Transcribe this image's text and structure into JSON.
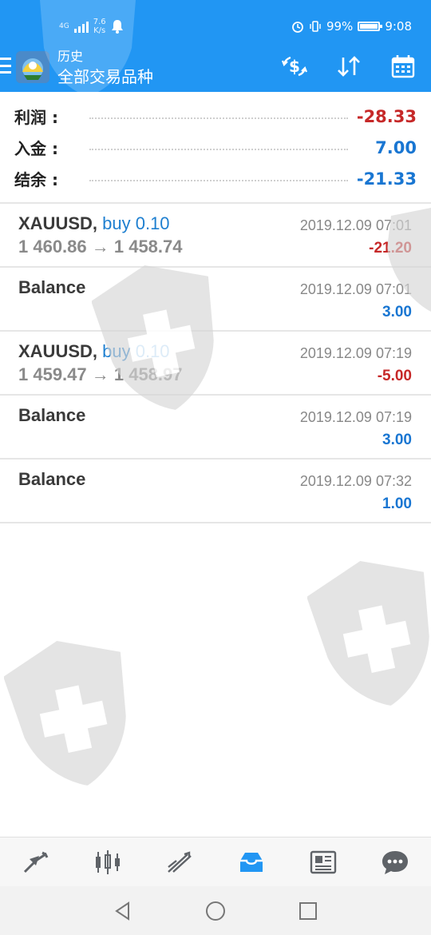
{
  "status_bar": {
    "network": "4G",
    "speed_value": "7.6",
    "speed_unit": "K/s",
    "battery": "99%",
    "time": "9:08"
  },
  "header": {
    "subtitle": "历史",
    "title": "全部交易品种",
    "icons": [
      "menu-icon",
      "currency-exchange-icon",
      "sort-icon",
      "calendar-icon"
    ]
  },
  "summary": {
    "profit_label": "利润 :",
    "profit_value": "-28.33",
    "deposit_label": "入金 :",
    "deposit_value": "7.00",
    "balance_label": "结余 :",
    "balance_value": "-21.33"
  },
  "history": [
    {
      "symbol": "XAUUSD,",
      "side": "buy 0.10",
      "prices": "1 460.86 → 1 458.74",
      "date": "2019.12.09 07:01",
      "amount": "-21.20"
    },
    {
      "symbol": "Balance",
      "side": "",
      "prices": "",
      "date": "2019.12.09 07:01",
      "amount": "3.00"
    },
    {
      "symbol": "XAUUSD,",
      "side": "buy 0.10",
      "prices": "1 459.47 → 1 458.97",
      "date": "2019.12.09 07:19",
      "amount": "-5.00"
    },
    {
      "symbol": "Balance",
      "side": "",
      "prices": "",
      "date": "2019.12.09 07:19",
      "amount": "3.00"
    },
    {
      "symbol": "Balance",
      "side": "",
      "prices": "",
      "date": "2019.12.09 07:32",
      "amount": "1.00"
    }
  ],
  "bottom_nav": [
    "quotes-icon",
    "chart-icon",
    "trade-icon",
    "history-icon",
    "news-icon",
    "chat-icon"
  ],
  "colors": {
    "header": "#2196f3",
    "negative": "#c62828",
    "positive": "#1976d2",
    "active_tab": "#2196f3"
  }
}
